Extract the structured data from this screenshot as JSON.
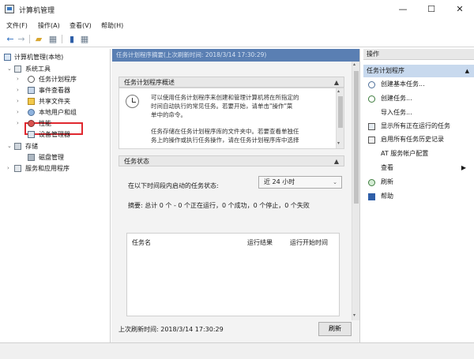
{
  "window": {
    "title": "计算机管理",
    "buttons": {
      "minimize": "—",
      "maximize": "☐",
      "close": "✕"
    }
  },
  "menubar": {
    "items": [
      "文件(F)",
      "操作(A)",
      "查看(V)",
      "帮助(H)"
    ]
  },
  "tree": {
    "root": "计算机管理(本地)",
    "items": [
      {
        "label": "系统工具",
        "expanded": true
      },
      {
        "label": "任务计划程序",
        "selected": true
      },
      {
        "label": "事件查看器"
      },
      {
        "label": "共享文件夹"
      },
      {
        "label": "本地用户和组"
      },
      {
        "label": "性能"
      },
      {
        "label": "设备管理器"
      },
      {
        "label": "存储",
        "expanded": true
      },
      {
        "label": "磁盘管理"
      },
      {
        "label": "服务和应用程序"
      }
    ]
  },
  "center": {
    "header": "任务计划程序摘要(上次刷新时间: 2018/3/14 17:30:29)",
    "overview": {
      "title": "任务计划程序概述",
      "lines": [
        "可以使用任务计划程序来创建和管理计算机将在所指定的",
        "时间自动执行的常见任务。若要开始，请单击\"操作\"菜",
        "单中的命令。",
        "任务存储在任务计划程序库的文件夹中。若要查看单独任",
        "务上的操作或执行任务操作，请在任务计划程序库中选择"
      ]
    },
    "status": {
      "title": "任务状态",
      "label": "在以下时间段内启动的任务状态:",
      "period": "近 24 小时",
      "summary": "摘要: 总计 0 个 - 0 个正在运行，0 个成功，0 个停止，0 个失败",
      "columns": [
        "任务名",
        "运行结果",
        "运行开始时间"
      ]
    },
    "footer": {
      "last_refresh": "上次刷新时间: 2018/3/14 17:30:29",
      "refresh_button": "刷新"
    }
  },
  "actions": {
    "header": "操作",
    "subheader": "任务计划程序",
    "items": [
      {
        "label": "创建基本任务...",
        "icon": "create-basic-task-icon"
      },
      {
        "label": "创建任务...",
        "icon": "create-task-icon"
      },
      {
        "label": "导入任务...",
        "icon": ""
      },
      {
        "label": "显示所有正在运行的任务",
        "icon": "running-tasks-icon"
      },
      {
        "label": "启用所有任务历史记录",
        "icon": "history-icon"
      },
      {
        "label": "AT 服务帐户配置",
        "icon": ""
      },
      {
        "label": "查看",
        "icon": ""
      },
      {
        "label": "刷新",
        "icon": "refresh-icon"
      },
      {
        "label": "帮助",
        "icon": "help-icon"
      }
    ]
  },
  "colors": {
    "header_blue": "#5a7fb3",
    "selection_blue": "#c8d9ee",
    "highlight_box": "#e0282f"
  }
}
